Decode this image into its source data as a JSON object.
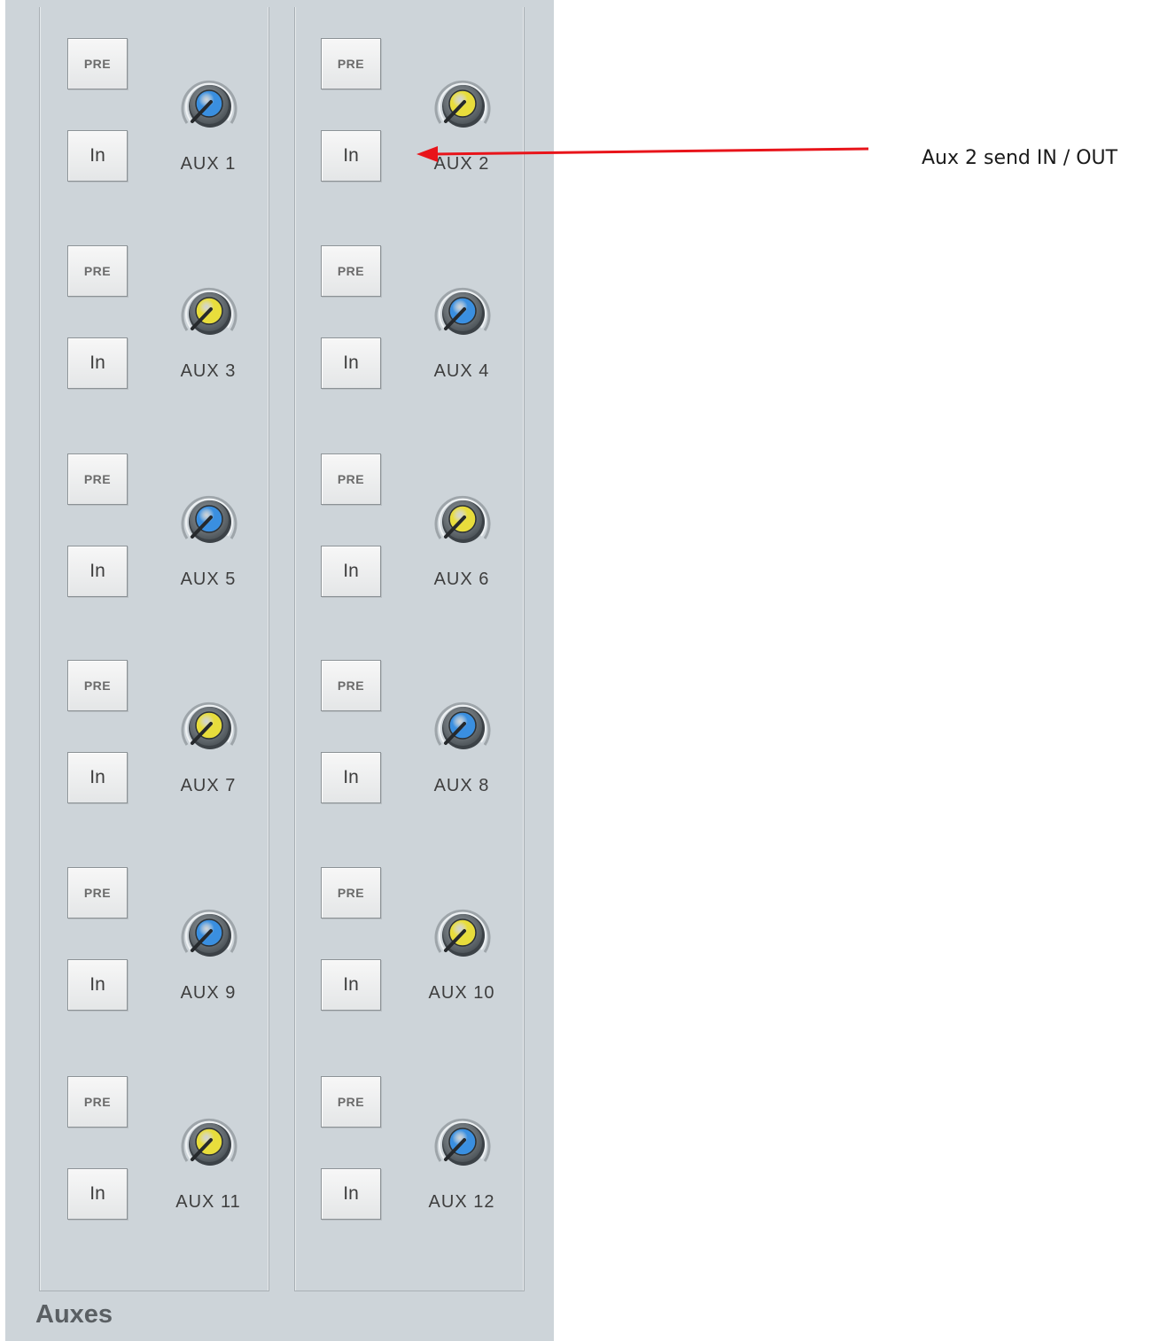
{
  "panel": {
    "title": "Auxes",
    "aux_sends": [
      {
        "label": "AUX 1",
        "pre_label": "PRE",
        "in_label": "In",
        "knob_color": "#3a8fe0"
      },
      {
        "label": "AUX 2",
        "pre_label": "PRE",
        "in_label": "In",
        "knob_color": "#e8dd3c"
      },
      {
        "label": "AUX 3",
        "pre_label": "PRE",
        "in_label": "In",
        "knob_color": "#e8dd3c"
      },
      {
        "label": "AUX 4",
        "pre_label": "PRE",
        "in_label": "In",
        "knob_color": "#3a8fe0"
      },
      {
        "label": "AUX 5",
        "pre_label": "PRE",
        "in_label": "In",
        "knob_color": "#3a8fe0"
      },
      {
        "label": "AUX 6",
        "pre_label": "PRE",
        "in_label": "In",
        "knob_color": "#e8dd3c"
      },
      {
        "label": "AUX 7",
        "pre_label": "PRE",
        "in_label": "In",
        "knob_color": "#e8dd3c"
      },
      {
        "label": "AUX 8",
        "pre_label": "PRE",
        "in_label": "In",
        "knob_color": "#3a8fe0"
      },
      {
        "label": "AUX 9",
        "pre_label": "PRE",
        "in_label": "In",
        "knob_color": "#3a8fe0"
      },
      {
        "label": "AUX 10",
        "pre_label": "PRE",
        "in_label": "In",
        "knob_color": "#e8dd3c"
      },
      {
        "label": "AUX 11",
        "pre_label": "PRE",
        "in_label": "In",
        "knob_color": "#e8dd3c"
      },
      {
        "label": "AUX 12",
        "pre_label": "PRE",
        "in_label": "In",
        "knob_color": "#3a8fe0"
      }
    ]
  },
  "annotation": {
    "text": "Aux 2 send IN / OUT",
    "arrow_color": "#e8141a"
  }
}
